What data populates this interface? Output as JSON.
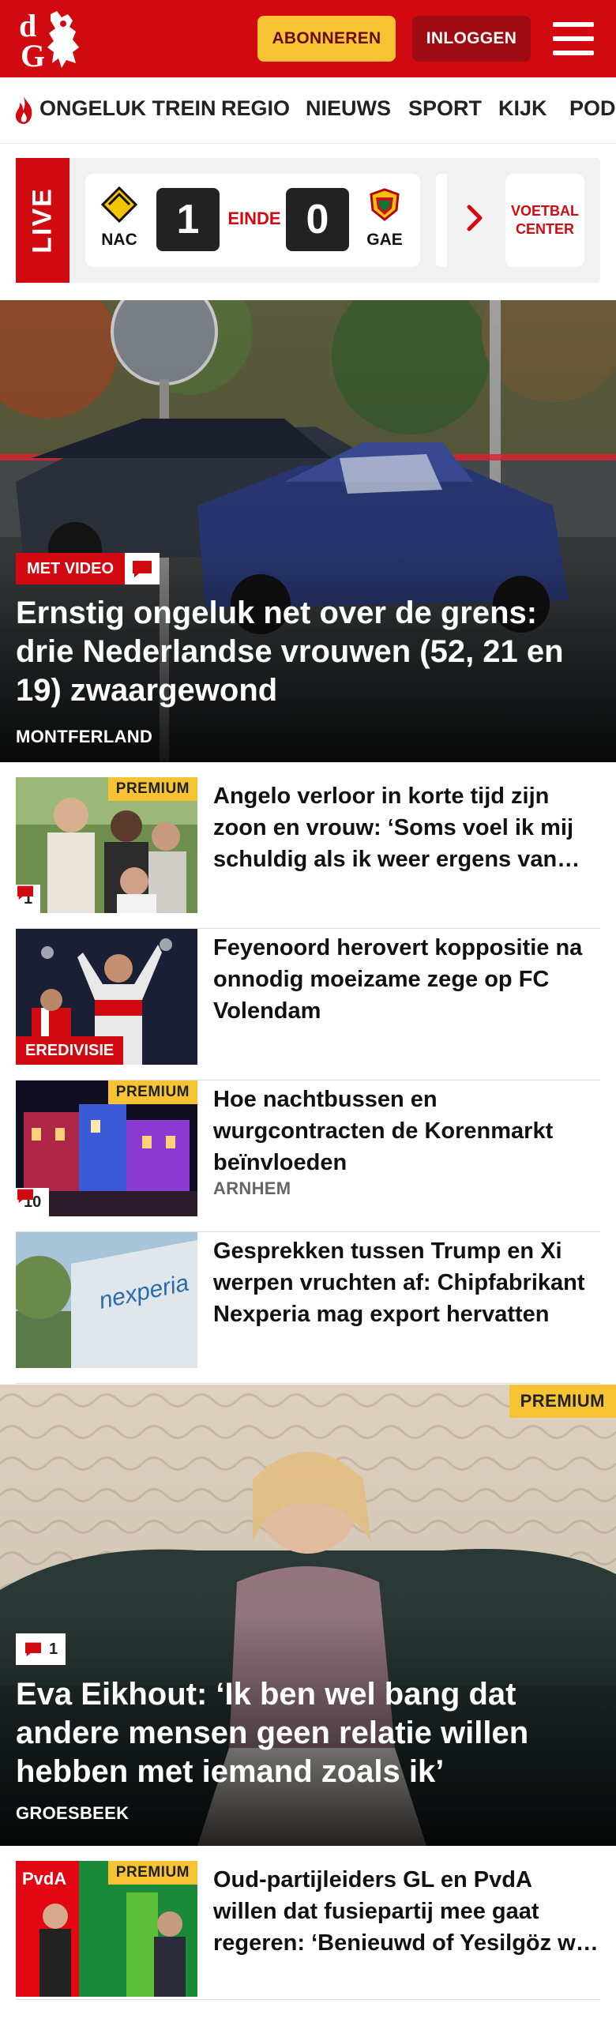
{
  "header": {
    "logo_text": "dG",
    "subscribe_label": "ABONNEREN",
    "login_label": "INLOGGEN",
    "brand_color": "#d10a11",
    "accent_color": "#f7c333"
  },
  "nav": {
    "items": [
      {
        "label": "ONGELUK TREIN",
        "icon": "flame-icon"
      },
      {
        "label": "REGIO"
      },
      {
        "label": "NIEUWS"
      },
      {
        "label": "SPORT"
      },
      {
        "label": "KIJK"
      },
      {
        "label": "POD"
      }
    ]
  },
  "live": {
    "label": "LIVE",
    "match": {
      "home_team": "NAC",
      "home_score": "1",
      "status": "EINDE",
      "away_score": "0",
      "away_team": "GAE"
    },
    "more_label": "VOETBAL CENTER"
  },
  "hero": {
    "badge": "MET VIDEO",
    "title": "Ernstig ongeluk net over de grens: drie Nederlandse vrouwen (52, 21 en 19) zwaargewond",
    "location": "MONTFERLAND"
  },
  "articles": [
    {
      "title": "Angelo verloor in korte tijd zijn zoon en vrouw: ‘Soms voel ik mij schuldig als ik weer ergens van genieten kan’",
      "premium": "PREMIUM",
      "comments": "1"
    },
    {
      "title": "Feyenoord herovert koppositie na onnodig moeizame zege op FC Volendam",
      "category": "EREDIVISIE"
    },
    {
      "title": "Hoe nachtbussen en wurgcontracten de Korenmarkt beïnvloeden",
      "premium": "PREMIUM",
      "comments": "10",
      "location": "ARNHEM"
    },
    {
      "title": "Gesprekken tussen Trump en Xi werpen vruchten af: Chipfabrikant Nexperia mag export hervatten"
    }
  ],
  "feature": {
    "premium": "PREMIUM",
    "comments": "1",
    "title": "Eva Eikhout: ‘Ik ben wel bang dat andere mensen geen relatie willen hebben met iemand zoals ik’",
    "location": "GROESBEEK"
  },
  "article_bottom": {
    "title": "Oud-partijleiders GL en PvdA willen dat fusiepartij mee gaat regeren: ‘Benieuwd of Yesilgöz wel durft’",
    "premium": "PREMIUM"
  }
}
